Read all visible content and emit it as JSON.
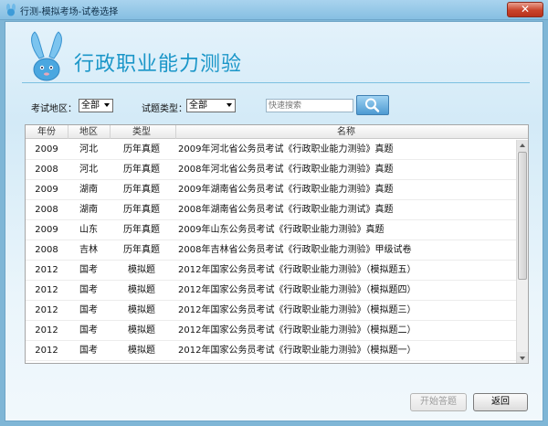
{
  "window": {
    "title": "行测-模拟考场-试卷选择",
    "close_label": "✕"
  },
  "header": {
    "title": "行政职业能力测验"
  },
  "filters": {
    "region_label": "考试地区：",
    "region_value": "全部",
    "type_label": "试题类型：",
    "type_value": "全部",
    "search_placeholder": "快速搜索"
  },
  "table": {
    "columns": [
      "年份",
      "地区",
      "类型",
      "名称"
    ],
    "rows": [
      [
        "2009",
        "河北",
        "历年真题",
        "2009年河北省公务员考试《行政职业能力测验》真题"
      ],
      [
        "2008",
        "河北",
        "历年真题",
        "2008年河北省公务员考试《行政职业能力测验》真题"
      ],
      [
        "2009",
        "湖南",
        "历年真题",
        "2009年湖南省公务员考试《行政职业能力测验》真题"
      ],
      [
        "2008",
        "湖南",
        "历年真题",
        "2008年湖南省公务员考试《行政职业能力测试》真题"
      ],
      [
        "2009",
        "山东",
        "历年真题",
        "2009年山东公务员考试《行政职业能力测验》真题"
      ],
      [
        "2008",
        "吉林",
        "历年真题",
        "2008年吉林省公务员考试《行政职业能力测验》甲级试卷"
      ],
      [
        "2012",
        "国考",
        "模拟题",
        "2012年国家公务员考试《行政职业能力测验》（模拟题五）"
      ],
      [
        "2012",
        "国考",
        "模拟题",
        "2012年国家公务员考试《行政职业能力测验》（模拟题四）"
      ],
      [
        "2012",
        "国考",
        "模拟题",
        "2012年国家公务员考试《行政职业能力测验》（模拟题三）"
      ],
      [
        "2012",
        "国考",
        "模拟题",
        "2012年国家公务员考试《行政职业能力测验》（模拟题二）"
      ],
      [
        "2012",
        "国考",
        "模拟题",
        "2012年国家公务员考试《行政职业能力测验》（模拟题一）"
      ]
    ]
  },
  "footer": {
    "start_label": "开始答题",
    "back_label": "返回"
  },
  "icons": {
    "app": "rabbit-logo-icon",
    "search": "magnifier-icon",
    "close": "close-icon"
  },
  "colors": {
    "accent": "#1a96c8",
    "titlebar": "#9ccbea",
    "close": "#c9432b"
  }
}
